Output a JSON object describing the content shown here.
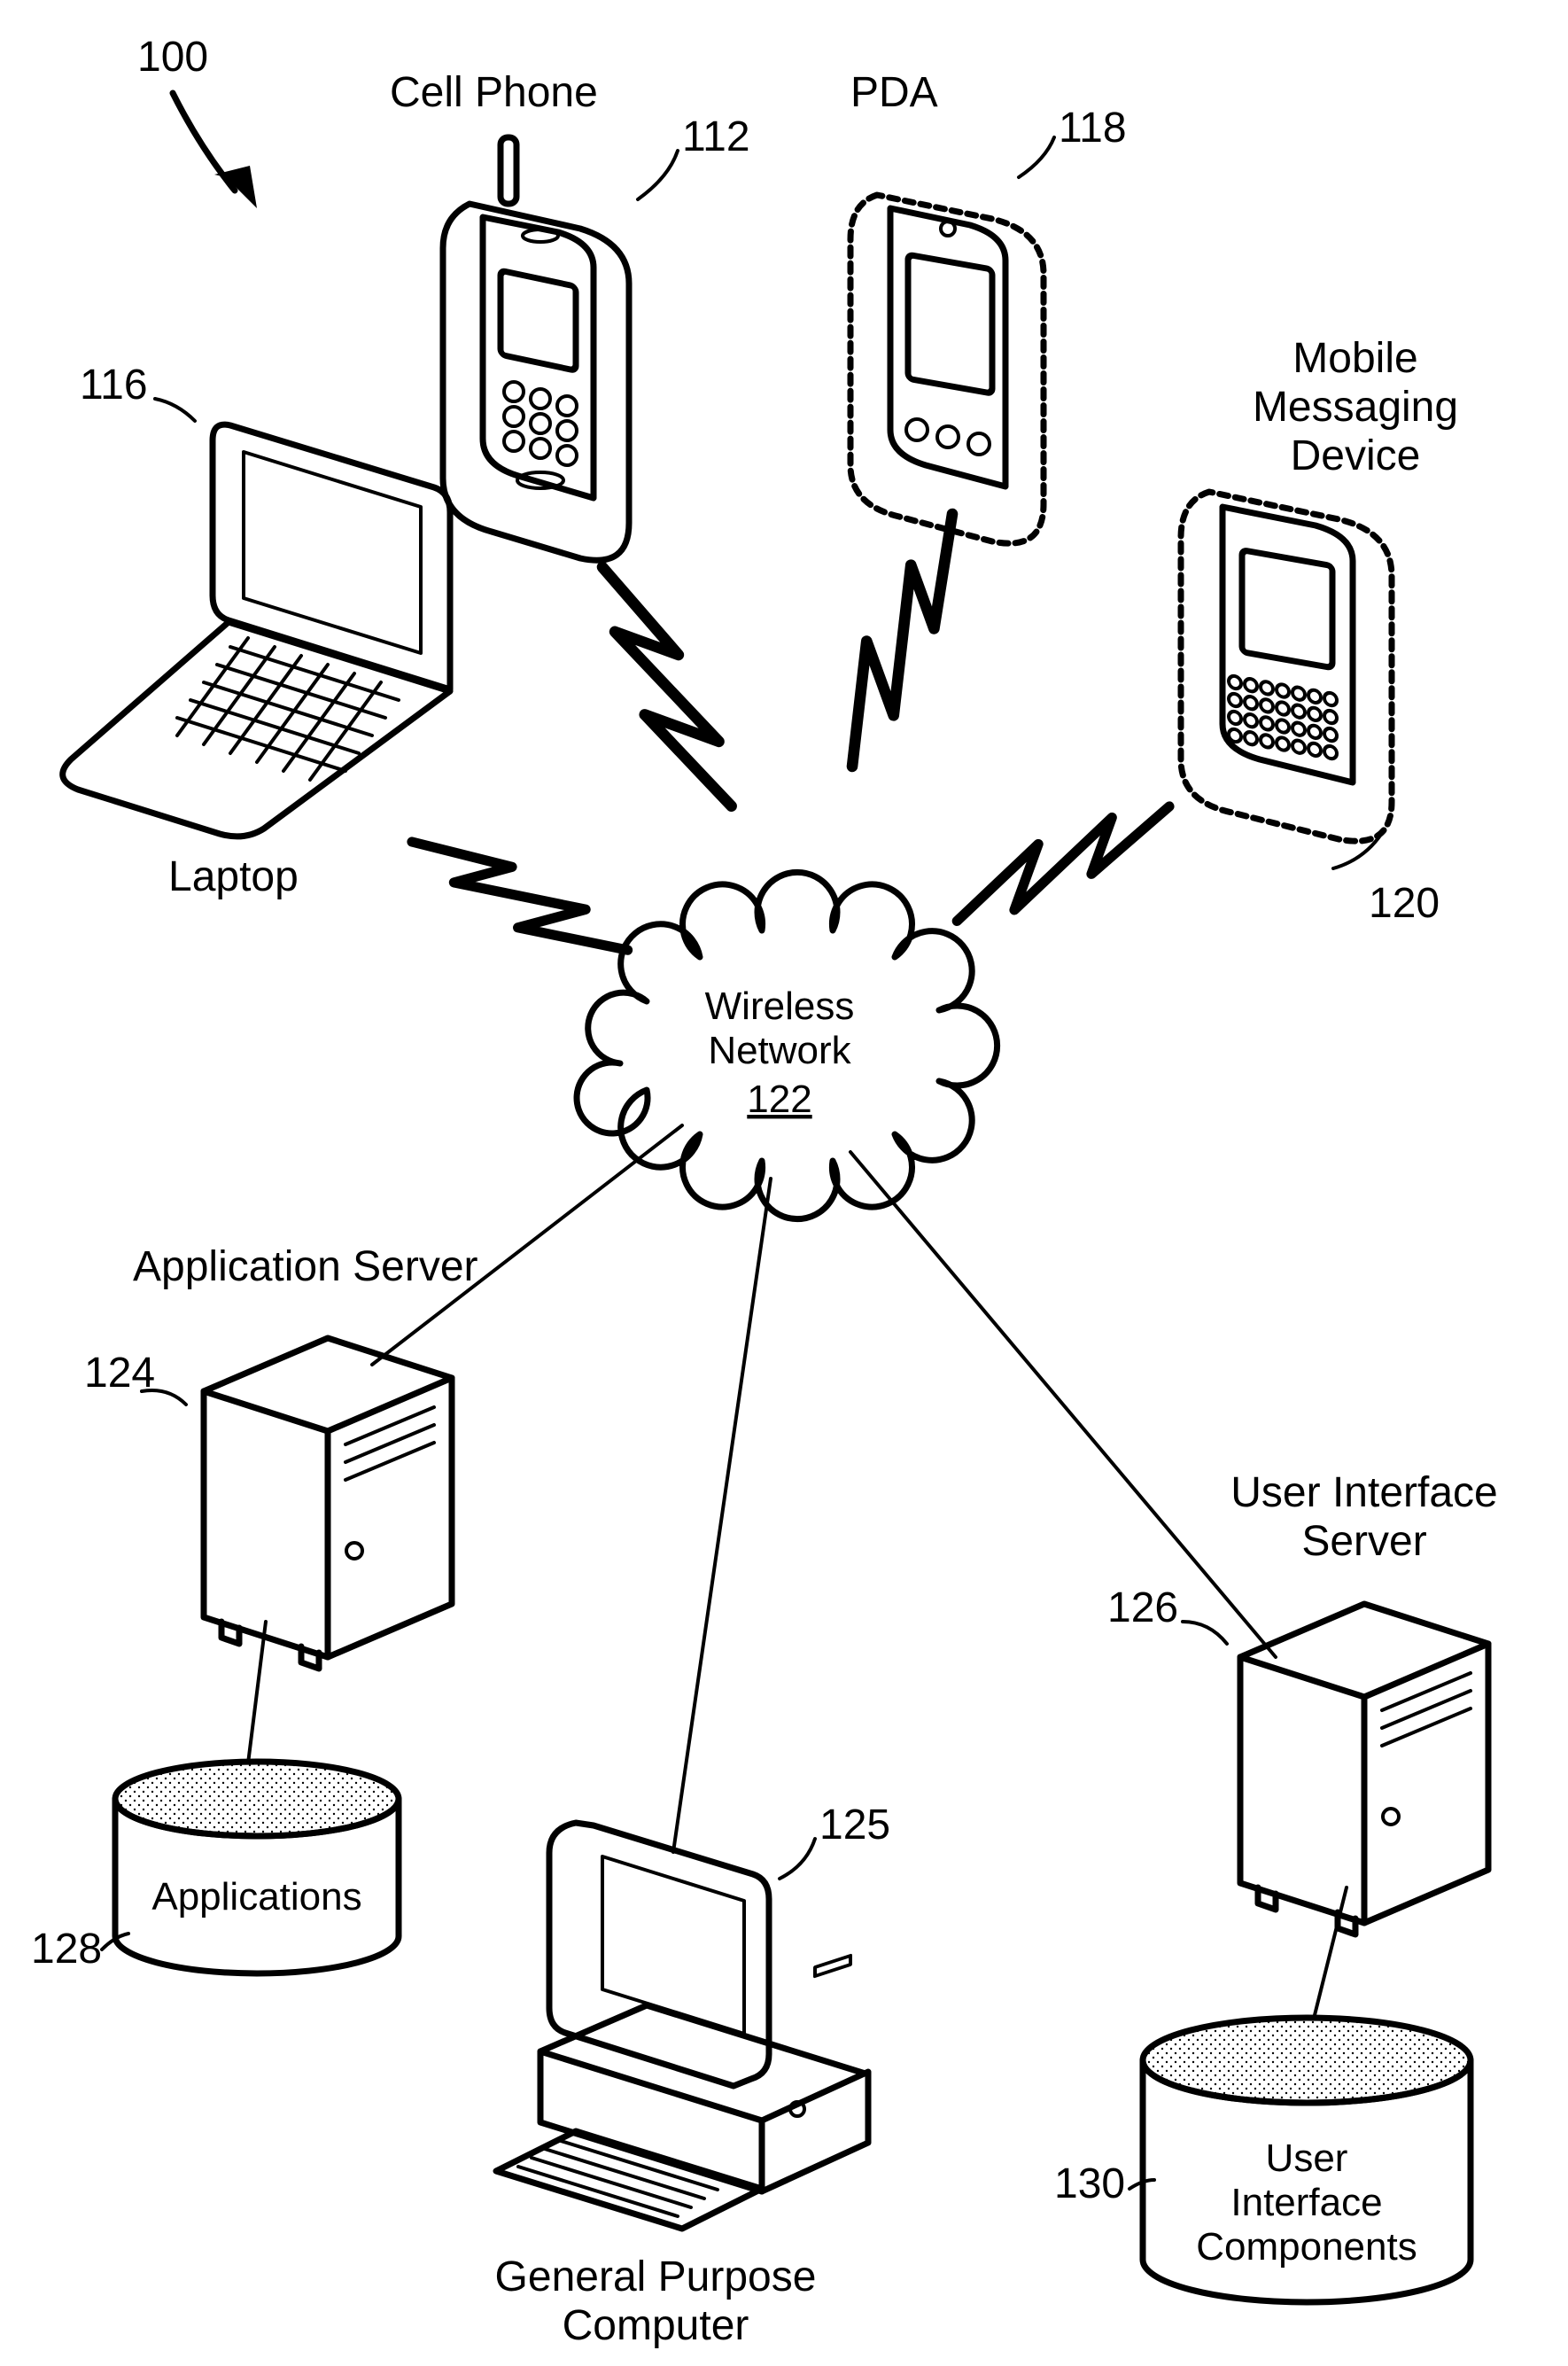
{
  "figure_ref": "100",
  "center": {
    "label_line1": "Wireless",
    "label_line2": "Network",
    "ref": "122"
  },
  "nodes": {
    "cellphone": {
      "label": "Cell Phone",
      "ref": "112"
    },
    "pda": {
      "label": "PDA",
      "ref": "118"
    },
    "laptop": {
      "label": "Laptop",
      "ref": "116"
    },
    "mobilemsg": {
      "label_l1": "Mobile",
      "label_l2": "Messaging",
      "label_l3": "Device",
      "ref": "120"
    },
    "appserver": {
      "label": "Application Server",
      "ref": "124"
    },
    "appdb": {
      "label": "Applications",
      "ref": "128"
    },
    "gpc": {
      "label_l1": "General Purpose",
      "label_l2": "Computer",
      "ref": "125"
    },
    "uiserver": {
      "label_l1": "User Interface",
      "label_l2": "Server",
      "ref": "126"
    },
    "uidb": {
      "label_l1": "User",
      "label_l2": "Interface",
      "label_l3": "Components",
      "ref": "130"
    }
  }
}
